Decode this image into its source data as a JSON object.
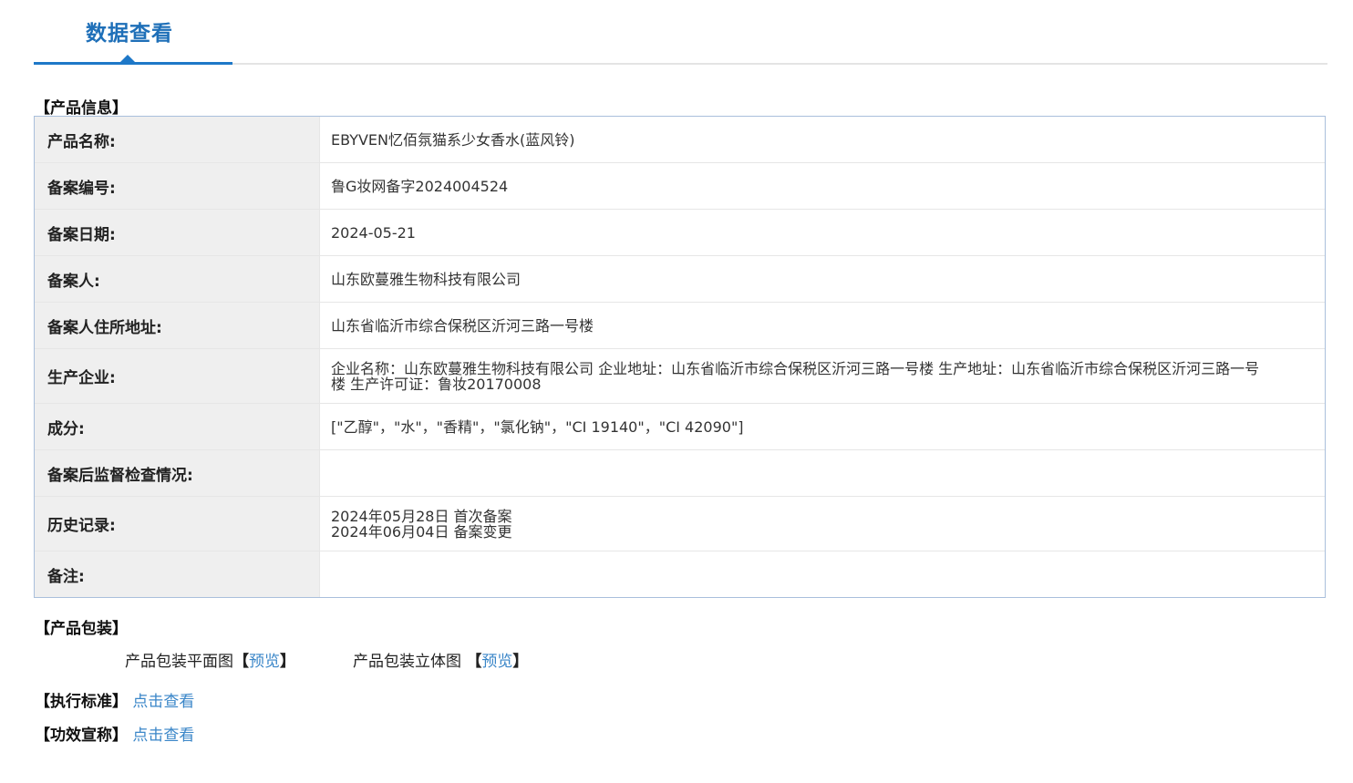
{
  "tab": {
    "title": "数据查看"
  },
  "product_info": {
    "heading": "【产品信息】",
    "rows": [
      {
        "label": "产品名称:",
        "value": "EBYVEN忆佰氛猫系少女香水(蓝风铃)"
      },
      {
        "label": "备案编号:",
        "value": "鲁G妆网备字2024004524"
      },
      {
        "label": "备案日期:",
        "value": "2024-05-21"
      },
      {
        "label": "备案人:",
        "value": "山东欧蔓雅生物科技有限公司"
      },
      {
        "label": "备案人住所地址:",
        "value": "山东省临沂市综合保税区沂河三路一号楼"
      },
      {
        "label": "生产企业:",
        "value": "企业名称：山东欧蔓雅生物科技有限公司 企业地址：山东省临沂市综合保税区沂河三路一号楼 生产地址：山东省临沂市综合保税区沂河三路一号楼 生产许可证：鲁妆20170008"
      },
      {
        "label": "成分:",
        "value": "[\"乙醇\"，\"水\"，\"香精\"，\"氯化钠\"，\"CI 19140\"，\"CI 42090\"]"
      },
      {
        "label": "备案后监督检查情况:",
        "value": ""
      },
      {
        "label": "历史记录:",
        "lines": [
          "2024年05月28日 首次备案",
          "2024年06月04日 备案变更"
        ]
      },
      {
        "label": "备注:",
        "value": ""
      }
    ]
  },
  "packaging": {
    "heading": "【产品包装】",
    "flat_label": "产品包装平面图",
    "flat_link": "预览",
    "solid_label": "产品包装立体图",
    "solid_link": "预览",
    "bracket_open": "【",
    "bracket_close": "】"
  },
  "standard": {
    "label": "【执行标准】",
    "link": "点击查看"
  },
  "efficacy": {
    "label": "【功效宣称】",
    "link": "点击查看"
  }
}
